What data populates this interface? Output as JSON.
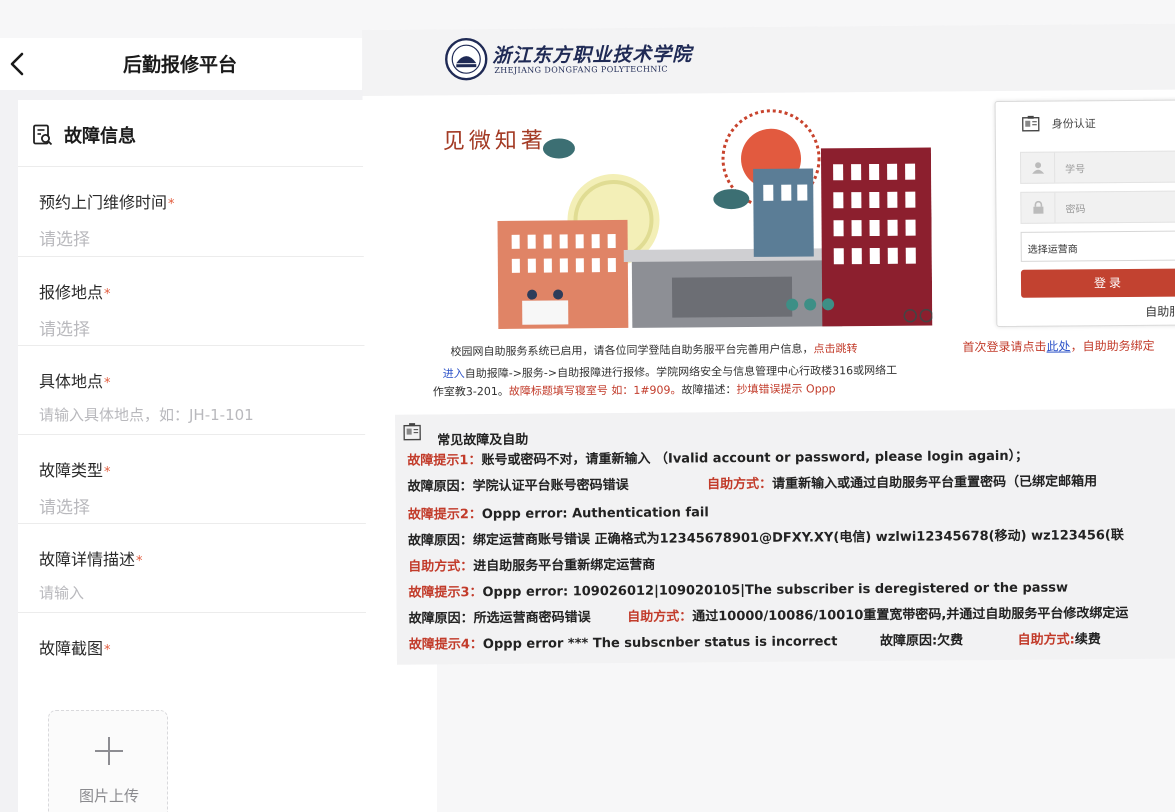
{
  "mobile": {
    "title": "后勤报修平台",
    "section_title": "故障信息",
    "fields": [
      {
        "label": "预约上门维修时间",
        "required": "*",
        "placeholder": "请选择"
      },
      {
        "label": "报修地点",
        "required": "*",
        "placeholder": "请选择"
      },
      {
        "label": "具体地点",
        "required": "*",
        "placeholder": "请输入具体地点，如：JH-1-101"
      },
      {
        "label": "故障类型",
        "required": "*",
        "placeholder": "请选择"
      },
      {
        "label": "故障详情描述",
        "required": "*",
        "placeholder": "请输入"
      },
      {
        "label": "故障截图",
        "required": "*"
      }
    ],
    "upload_label": "图片上传"
  },
  "portal": {
    "school_name_cn": "浙江东方职业技术学院",
    "school_name_en": "ZHEJIANG DONGFANG POLYTECHNIC",
    "slogan": "见微知著",
    "login": {
      "header": "身份认证",
      "username_placeholder": "学号",
      "password_placeholder": "密码",
      "carrier_select": "选择运营商",
      "login_button": "登录",
      "self_service": "自助服"
    },
    "notice": {
      "line1": "校园网自助服务系统已启用，请各位同学登陆自助务服平台完善用户信息，",
      "line1_link": "点击跳转",
      "line2_link": "进入",
      "line2": "自助报障->服务->自助报障进行报修。学院网络安全与信息管理中心行政楼316或网络工",
      "line3": "作室教3-201。",
      "line3_red": "故障标题填写寝室号  如：1#909。",
      "line3_mid": "故障描述：",
      "line3_red2": "抄填错误提示 Oppp",
      "first_login_prefix": "首次登录请点击",
      "first_login_link": "此处",
      "first_login_suffix": "，自助助务绑定"
    },
    "faq": {
      "title": "常见故障及自助",
      "items": [
        {
          "label": "故障提示1：",
          "text": "账号或密码不对，请重新输入 （Ivalid account or password, please login again）；"
        },
        {
          "label": "故障原因：",
          "text": "学院认证平台账号密码错误",
          "fix_label": "自助方式：",
          "fix_text": "请重新输入或通过自助服务平台重置密码（已绑定邮箱用"
        },
        {
          "label": "故障提示2：",
          "text": "Oppp error: Authentication fail"
        },
        {
          "label": "故障原因：",
          "text": "绑定运营商账号错误 正确格式为12345678901@DFXY.XY(电信) wzlwi12345678(移动) wz123456(联"
        },
        {
          "label": "自助方式：",
          "text": "进自助服务平台重新绑定运营商"
        },
        {
          "label": "故障提示3：",
          "text": "Oppp error: 109026012|109020105|The subscriber is deregistered or the passw"
        },
        {
          "label": "故障原因：",
          "text": "所选运营商密码错误",
          "fix_label": "自助方式：",
          "fix_text": "通过10000/10086/10010重置宽带密码,并通过自助服务平台修改绑定运"
        },
        {
          "label": "故障提示4：",
          "text": "Oppp error *** The subscnber status is incorrect",
          "cause": "故障原因:欠费",
          "fix_label": "自助方式:",
          "fix_text": "续费"
        }
      ]
    }
  }
}
